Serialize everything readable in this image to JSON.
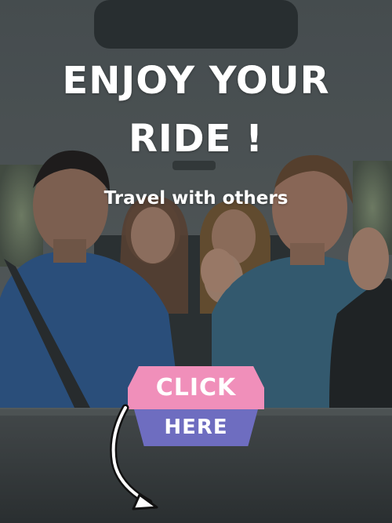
{
  "poster": {
    "headline_line1": "ENJOY YOUR",
    "headline_line2": "RIDE !",
    "subtitle": "Travel with others",
    "cta": {
      "top_label": "CLICK",
      "bottom_label": "HERE"
    }
  },
  "colors": {
    "cta_top": "#f08fba",
    "cta_bottom": "#6e6dc0",
    "text": "#ffffff"
  },
  "icons": {
    "arrow": "curved-arrow-down-icon"
  }
}
